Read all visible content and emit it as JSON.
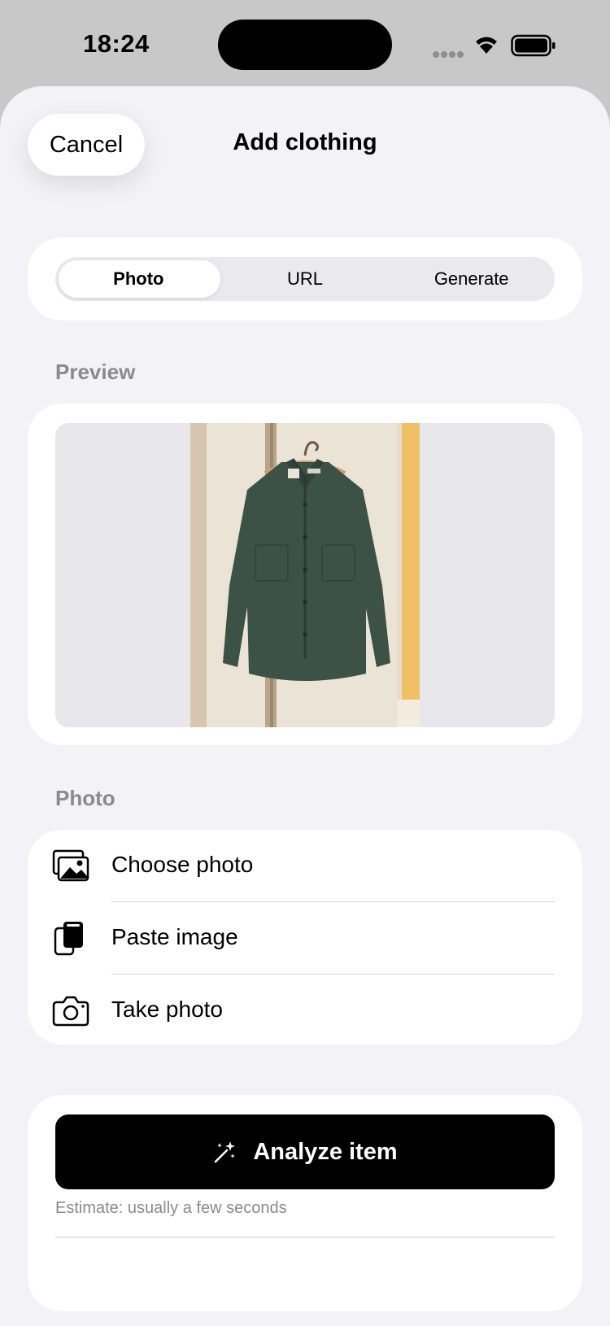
{
  "status_bar": {
    "time": "18:24"
  },
  "header": {
    "cancel_label": "Cancel",
    "title": "Add clothing"
  },
  "source_tabs": {
    "items": [
      {
        "label": "Photo",
        "selected": true
      },
      {
        "label": "URL",
        "selected": false
      },
      {
        "label": "Generate",
        "selected": false
      }
    ]
  },
  "preview": {
    "section_label": "Preview"
  },
  "photo": {
    "section_label": "Photo",
    "actions": [
      {
        "label": "Choose photo",
        "icon": "photo-stack-icon"
      },
      {
        "label": "Paste image",
        "icon": "paste-icon"
      },
      {
        "label": "Take photo",
        "icon": "camera-icon"
      }
    ]
  },
  "analyze": {
    "button_label": "Analyze item",
    "icon": "magic-wand-icon",
    "estimate": "Estimate: usually a few seconds"
  },
  "colors": {
    "accent": "#000000",
    "background": "#f2f2f7",
    "card": "#ffffff",
    "secondary_text": "#8a8a8e"
  }
}
